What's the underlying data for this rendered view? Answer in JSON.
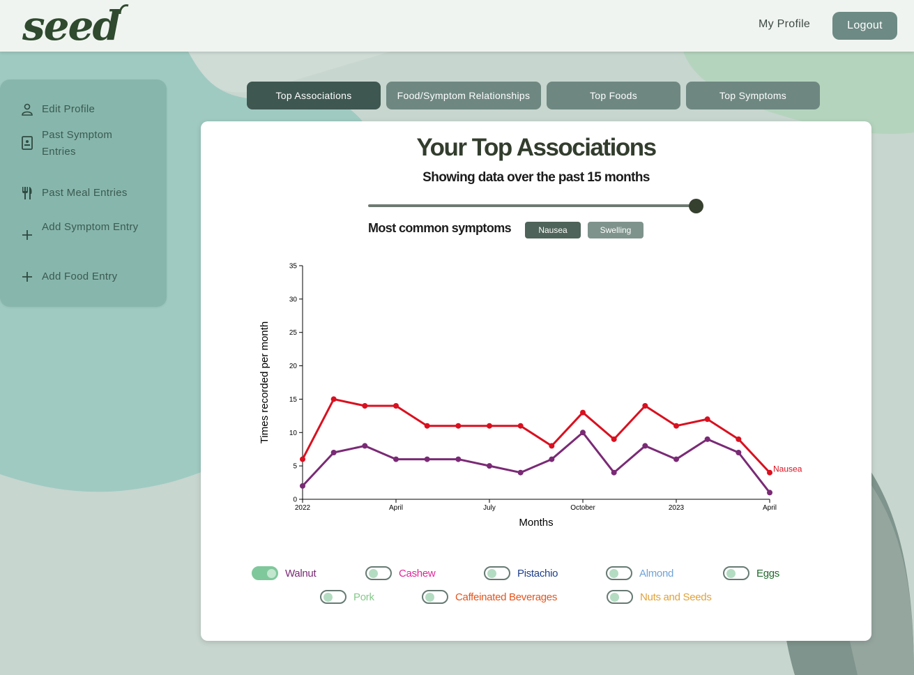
{
  "brand": {
    "logo_text": "seed"
  },
  "header": {
    "my_profile_label": "My Profile",
    "logout_label": "Logout"
  },
  "sidebar": {
    "items": [
      {
        "label": "Edit Profile",
        "icon": "user-icon"
      },
      {
        "label": "Past Symptom Entries",
        "icon": "clipboard-icon"
      },
      {
        "label": "Past Meal Entries",
        "icon": "fork-knife-icon"
      },
      {
        "label": "Add Symptom Entry",
        "icon": "plus-icon"
      },
      {
        "label": "Add Food Entry",
        "icon": "plus-icon"
      }
    ]
  },
  "tabs": [
    {
      "label": "Top Associations",
      "active": true
    },
    {
      "label": "Food/Symptom Relationships",
      "active": false
    },
    {
      "label": "Top Foods",
      "active": false
    },
    {
      "label": "Top Symptoms",
      "active": false
    }
  ],
  "main": {
    "title": "Your Top Associations",
    "subtitle": "Showing data over the past 15 months",
    "slider_value_months": 15,
    "symptoms_label": "Most common symptoms",
    "symptom_buttons": [
      {
        "label": "Nausea",
        "active": true
      },
      {
        "label": "Swelling",
        "active": false
      }
    ]
  },
  "colors": {
    "nausea": "#d9101f",
    "walnut": "#7a2a75",
    "accent_dark": "#3e5750",
    "accent": "#6e8781"
  },
  "chart_data": {
    "type": "line",
    "xlabel": "Months",
    "ylabel": "Times recorded per month",
    "ylim": [
      0,
      35
    ],
    "yticks": [
      0,
      5,
      10,
      15,
      20,
      25,
      30,
      35
    ],
    "xtick_labels": [
      {
        "index": 0,
        "label": "2022"
      },
      {
        "index": 3,
        "label": "April"
      },
      {
        "index": 6,
        "label": "July"
      },
      {
        "index": 9,
        "label": "October"
      },
      {
        "index": 12,
        "label": "2023"
      },
      {
        "index": 15,
        "label": "April"
      }
    ],
    "x_months": [
      "2022-01",
      "2022-02",
      "2022-03",
      "2022-04",
      "2022-05",
      "2022-06",
      "2022-07",
      "2022-08",
      "2022-09",
      "2022-10",
      "2022-11",
      "2022-12",
      "2023-01",
      "2023-02",
      "2023-03",
      "2023-04"
    ],
    "series": [
      {
        "name": "Nausea",
        "values": [
          6,
          15,
          14,
          14,
          11,
          11,
          11,
          11,
          8,
          13,
          9,
          14,
          11,
          12,
          9,
          4
        ]
      },
      {
        "name": "Walnut",
        "values": [
          2,
          7,
          8,
          6,
          6,
          6,
          5,
          4,
          6,
          10,
          4,
          8,
          6,
          9,
          7,
          1
        ]
      }
    ]
  },
  "legend": {
    "items": [
      {
        "label": "Walnut",
        "color": "#7a2a75",
        "on": true
      },
      {
        "label": "Cashew",
        "color": "#e0259a",
        "on": false
      },
      {
        "label": "Pistachio",
        "color": "#1f3f8a",
        "on": false
      },
      {
        "label": "Almond",
        "color": "#6fa3d8",
        "on": false
      },
      {
        "label": "Eggs",
        "color": "#1f6a2c",
        "on": false
      },
      {
        "label": "Pork",
        "color": "#86c98a",
        "on": false
      },
      {
        "label": "Caffeinated Beverages",
        "color": "#e4541c",
        "on": false
      },
      {
        "label": "Nuts and Seeds",
        "color": "#e0a23a",
        "on": false
      }
    ]
  }
}
